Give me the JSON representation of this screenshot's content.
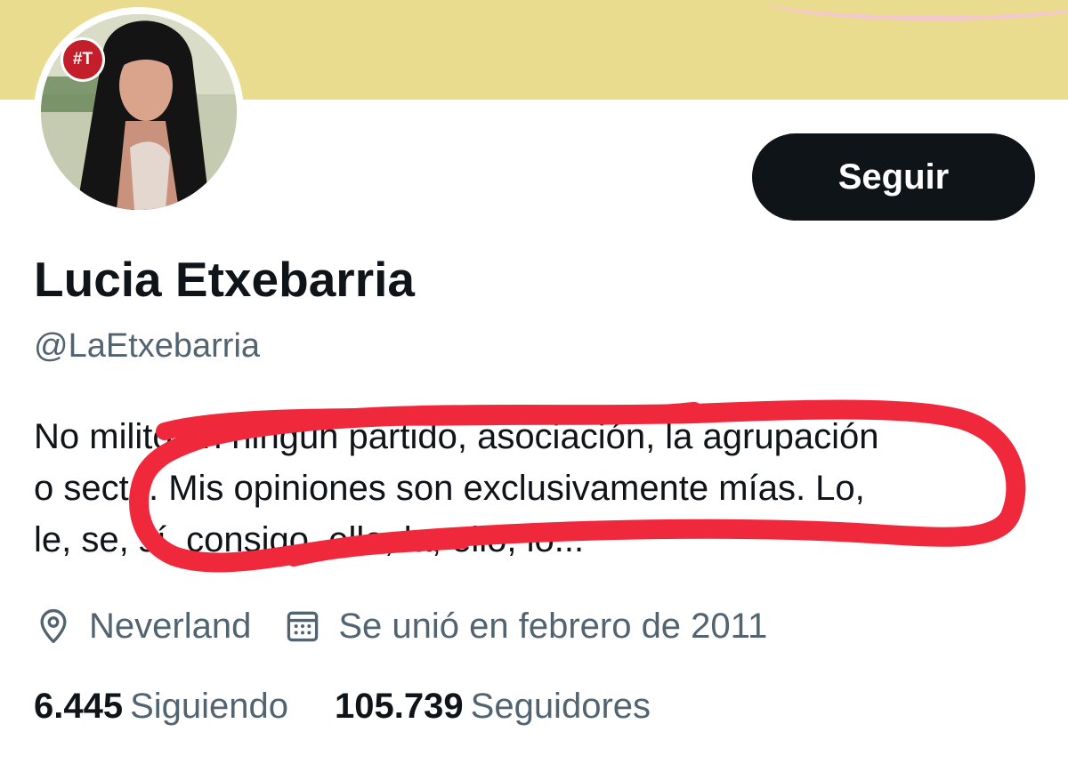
{
  "profile": {
    "display_name": "Lucia Etxebarria",
    "handle": "@LaEtxebarria",
    "avatar_badge": "#T",
    "follow_label": "Seguir",
    "bio_lines": [
      "No milito en ningún partido, asociación, la agrupación",
      "o secta. Mis opiniones son exclusivamente mías. Lo,",
      "le, se, sí, consigo, ello, la, ello, lo..."
    ],
    "location": "Neverland",
    "joined": "Se unió en febrero de 2011",
    "following_count": "6.445",
    "following_label": "Siguiendo",
    "followers_count": "105.739",
    "followers_label": "Seguidores"
  },
  "icons": {
    "location": "location-pin-icon",
    "calendar": "calendar-icon"
  },
  "colors": {
    "banner": "#e9dc8f",
    "button_bg": "#0f1419",
    "secondary_text": "#536471",
    "annotation": "#f0283c"
  }
}
